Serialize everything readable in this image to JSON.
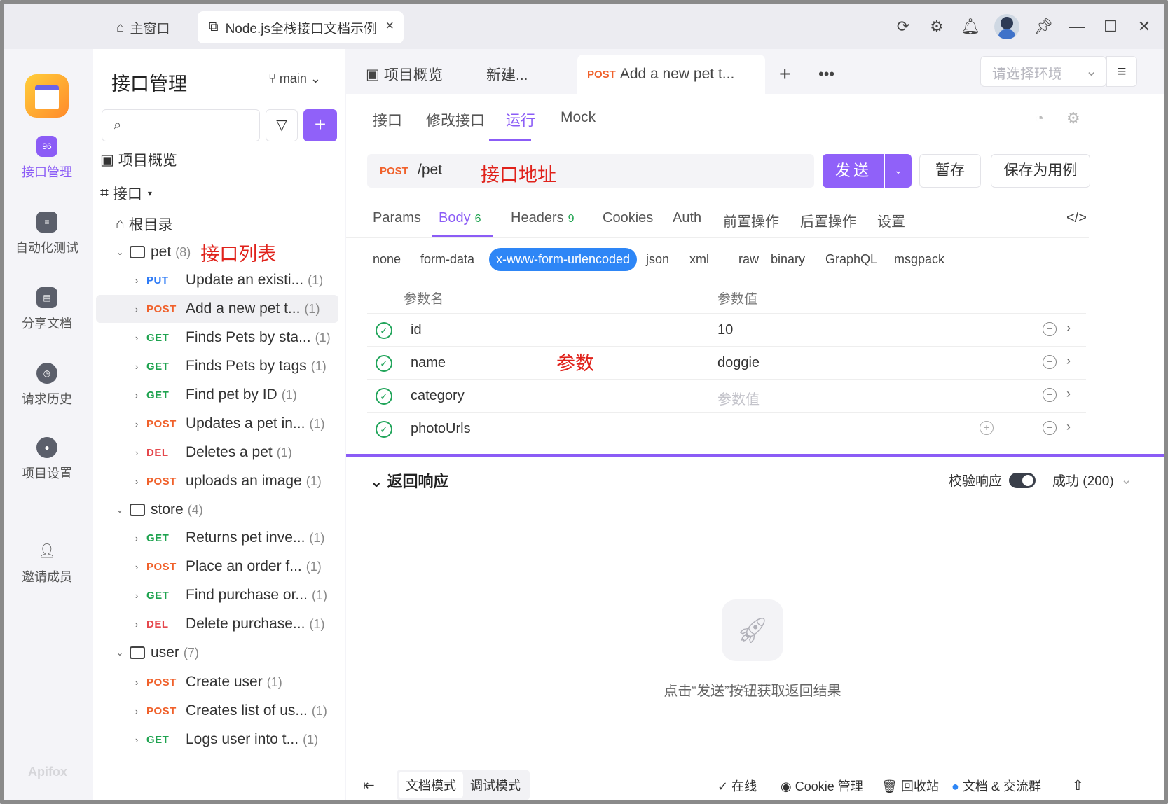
{
  "titlebar": {
    "home_label": "主窗口",
    "tab_title": "Node.js全栈接口文档示例",
    "close": "×"
  },
  "rail": {
    "items": [
      {
        "label": "接口管理",
        "active": true,
        "icon": "api-icon"
      },
      {
        "label": "自动化测试",
        "icon": "test-icon"
      },
      {
        "label": "分享文档",
        "icon": "book-icon"
      },
      {
        "label": "请求历史",
        "icon": "clock-icon"
      },
      {
        "label": "项目设置",
        "icon": "settings-icon"
      },
      {
        "label": "邀请成员",
        "icon": "add-user-icon"
      }
    ],
    "brand": "Apifox"
  },
  "left": {
    "title": "接口管理",
    "branch": "main",
    "overview": "项目概览",
    "api_group": "接口",
    "root": "根目录",
    "annotation": "接口列表",
    "folders": {
      "pet": {
        "name": "pet",
        "count": "(8)"
      },
      "store": {
        "name": "store",
        "count": "(4)"
      },
      "user": {
        "name": "user",
        "count": "(7)"
      }
    },
    "pet_items": [
      {
        "method": "PUT",
        "name": "Update an existi...",
        "count": "(1)"
      },
      {
        "method": "POST",
        "name": "Add a new pet t...",
        "count": "(1)"
      },
      {
        "method": "GET",
        "name": "Finds Pets by sta...",
        "count": "(1)"
      },
      {
        "method": "GET",
        "name": "Finds Pets by tags",
        "count": "(1)"
      },
      {
        "method": "GET",
        "name": "Find pet by ID",
        "count": "(1)"
      },
      {
        "method": "POST",
        "name": "Updates a pet in...",
        "count": "(1)"
      },
      {
        "method": "DEL",
        "name": "Deletes a pet",
        "count": "(1)"
      },
      {
        "method": "POST",
        "name": "uploads an image",
        "count": "(1)"
      }
    ],
    "store_items": [
      {
        "method": "GET",
        "name": "Returns pet inve...",
        "count": "(1)"
      },
      {
        "method": "POST",
        "name": "Place an order f...",
        "count": "(1)"
      },
      {
        "method": "GET",
        "name": "Find purchase or...",
        "count": "(1)"
      },
      {
        "method": "DEL",
        "name": "Delete purchase...",
        "count": "(1)"
      }
    ],
    "user_items": [
      {
        "method": "POST",
        "name": "Create user",
        "count": "(1)"
      },
      {
        "method": "POST",
        "name": "Creates list of us...",
        "count": "(1)"
      },
      {
        "method": "GET",
        "name": "Logs user into t...",
        "count": "(1)"
      }
    ]
  },
  "tabs": {
    "overview": "项目概览",
    "new": "新建...",
    "active_method": "POST",
    "active_title": "Add a new pet t...",
    "env_placeholder": "请选择环境"
  },
  "subtabs": [
    "接口",
    "修改接口",
    "运行",
    "Mock"
  ],
  "request": {
    "method": "POST",
    "path": "/pet",
    "annotation": "接口地址",
    "send": "发送",
    "save": "暂存",
    "save_case": "保存为用例"
  },
  "req_tabs": {
    "params": "Params",
    "body": "Body",
    "body_count": "6",
    "headers": "Headers",
    "headers_count": "9",
    "cookies": "Cookies",
    "auth": "Auth",
    "pre": "前置操作",
    "post": "后置操作",
    "settings": "设置"
  },
  "body_types": [
    "none",
    "form-data",
    "x-www-form-urlencoded",
    "json",
    "xml",
    "raw",
    "binary",
    "GraphQL",
    "msgpack"
  ],
  "params": {
    "col_name": "参数名",
    "col_value": "参数值",
    "annotation": "参数",
    "rows": [
      {
        "name": "id",
        "value": "10"
      },
      {
        "name": "name",
        "value": "doggie"
      },
      {
        "name": "category",
        "value": "参数值",
        "placeholder": true
      },
      {
        "name": "photoUrls",
        "value": ""
      }
    ]
  },
  "response": {
    "title": "返回响应",
    "validate": "校验响应",
    "status": "成功 (200)",
    "empty": "点击“发送”按钮获取返回结果"
  },
  "status": {
    "doc_mode": "文档模式",
    "debug_mode": "调试模式",
    "online": "在线",
    "cookie": "Cookie 管理",
    "trash": "回收站",
    "community": "文档 & 交流群"
  }
}
